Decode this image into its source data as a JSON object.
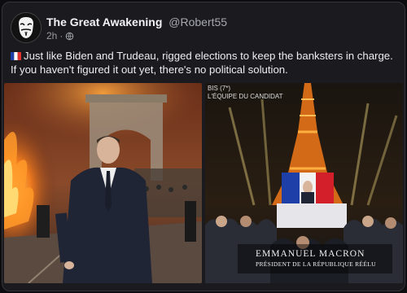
{
  "post": {
    "author_name": "The Great Awakening",
    "author_handle": "@Robert55",
    "time": "2h",
    "separator": "·",
    "visibility_icon": "globe-icon",
    "flag_icon": "france-flag-icon",
    "text": "Just like Biden and Trudeau, rigged elections to keep the banksters in charge. If you haven't figured it out yet, there's no political solution."
  },
  "media": {
    "image2": {
      "channel": "BIS (7*)",
      "program": "L'ÉQUIPE DU CANDIDAT",
      "caption_name": "EMMANUEL MACRON",
      "caption_title": "PRÉSIDENT DE LA RÉPUBLIQUE RÉÉLU"
    }
  },
  "colors": {
    "background": "#1b1b1f",
    "text": "#ececf1",
    "muted": "#9a9aa3"
  }
}
